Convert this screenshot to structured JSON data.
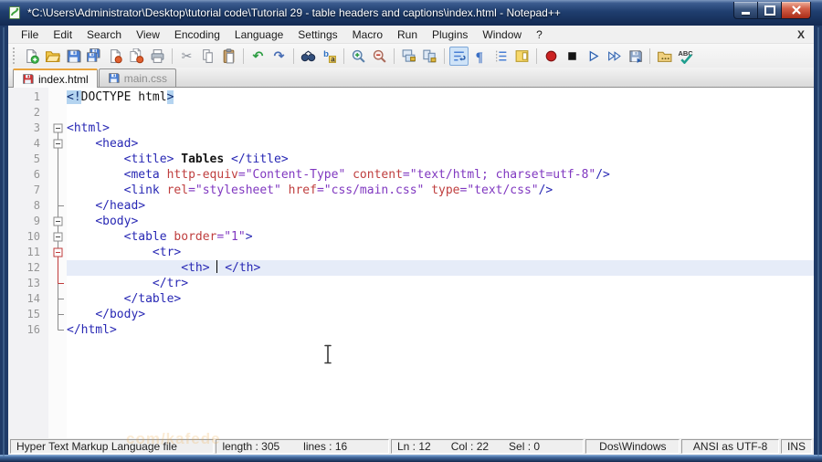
{
  "window": {
    "title": "*C:\\Users\\Administrator\\Desktop\\tutorial code\\Tutorial 29 - table headers and captions\\index.html - Notepad++"
  },
  "menu": {
    "items": [
      "File",
      "Edit",
      "Search",
      "View",
      "Encoding",
      "Language",
      "Settings",
      "Macro",
      "Run",
      "Plugins",
      "Window",
      "?"
    ],
    "right_close": "X"
  },
  "toolbar": {
    "items": [
      "new-file",
      "open-folder",
      "save",
      "save-all",
      "close-doc",
      "close-all",
      "print",
      "|",
      "cut",
      "copy",
      "paste",
      "|",
      "undo",
      "redo",
      "|",
      "find",
      "replace",
      "|",
      "zoom-in",
      "zoom-out",
      "|",
      "sync-v",
      "sync-h",
      "|",
      {
        "n": "word-wrap",
        "pressed": true
      },
      "show-all-chars",
      "indent-guide",
      "doc-map",
      "|",
      "macro-record",
      "macro-stop",
      "macro-play",
      "macro-multi",
      "macro-save",
      "|",
      "folder-workspace",
      "spell-check"
    ]
  },
  "tabs": [
    {
      "label": "index.html",
      "modified": true,
      "active": true
    },
    {
      "label": "main.css",
      "modified": false,
      "active": false
    }
  ],
  "editor": {
    "current_line": 12,
    "lines": [
      {
        "n": 1,
        "segs": [
          [
            "hl",
            "<!"
          ],
          [
            "plain",
            "DOCTYPE html"
          ],
          [
            "hl",
            ">"
          ]
        ]
      },
      {
        "n": 2,
        "segs": []
      },
      {
        "n": 3,
        "segs": [
          [
            "tag",
            "<html>"
          ]
        ]
      },
      {
        "n": 4,
        "segs": [
          [
            "plain",
            "    "
          ],
          [
            "tag",
            "<head>"
          ]
        ]
      },
      {
        "n": 5,
        "segs": [
          [
            "plain",
            "        "
          ],
          [
            "tag",
            "<title>"
          ],
          [
            "text",
            " Tables "
          ],
          [
            "tag",
            "</title>"
          ]
        ]
      },
      {
        "n": 6,
        "segs": [
          [
            "plain",
            "        "
          ],
          [
            "tag",
            "<meta "
          ],
          [
            "attr",
            "http-equiv"
          ],
          [
            "val",
            "=\"Content-Type\""
          ],
          [
            "plain",
            " "
          ],
          [
            "attr",
            "content"
          ],
          [
            "val",
            "=\"text/html; charset=utf-8\""
          ],
          [
            "tag",
            "/>"
          ]
        ]
      },
      {
        "n": 7,
        "segs": [
          [
            "plain",
            "        "
          ],
          [
            "tag",
            "<link "
          ],
          [
            "attr",
            "rel"
          ],
          [
            "val",
            "=\"stylesheet\""
          ],
          [
            "plain",
            " "
          ],
          [
            "attr",
            "href"
          ],
          [
            "val",
            "=\"css/main.css\""
          ],
          [
            "plain",
            " "
          ],
          [
            "attr",
            "type"
          ],
          [
            "val",
            "=\"text/css\""
          ],
          [
            "tag",
            "/>"
          ]
        ]
      },
      {
        "n": 8,
        "segs": [
          [
            "plain",
            "    "
          ],
          [
            "tag",
            "</head>"
          ]
        ]
      },
      {
        "n": 9,
        "segs": [
          [
            "plain",
            "    "
          ],
          [
            "tag",
            "<body>"
          ]
        ]
      },
      {
        "n": 10,
        "segs": [
          [
            "plain",
            "        "
          ],
          [
            "tag",
            "<table "
          ],
          [
            "attr",
            "border"
          ],
          [
            "val",
            "=\"1\""
          ],
          [
            "tag",
            ">"
          ]
        ]
      },
      {
        "n": 11,
        "segs": [
          [
            "plain",
            "            "
          ],
          [
            "tag",
            "<tr>"
          ]
        ]
      },
      {
        "n": 12,
        "segs": [
          [
            "plain",
            "                "
          ],
          [
            "tag",
            "<th>"
          ],
          [
            "plain",
            " "
          ],
          [
            "caret",
            ""
          ],
          [
            "plain",
            " "
          ],
          [
            "tag",
            "</th>"
          ]
        ]
      },
      {
        "n": 13,
        "segs": [
          [
            "plain",
            "            "
          ],
          [
            "tag",
            "</tr>"
          ]
        ]
      },
      {
        "n": 14,
        "segs": [
          [
            "plain",
            "        "
          ],
          [
            "tag",
            "</table>"
          ]
        ]
      },
      {
        "n": 15,
        "segs": [
          [
            "plain",
            "    "
          ],
          [
            "tag",
            "</body>"
          ]
        ]
      },
      {
        "n": 16,
        "segs": [
          [
            "tag",
            "</html>"
          ]
        ]
      }
    ],
    "folds": {
      "boxes": [
        3,
        4,
        9,
        10,
        11
      ],
      "red_box": 11,
      "spine": [
        3,
        16
      ],
      "ticks": [
        8,
        14,
        15,
        16
      ],
      "red_spine": [
        11,
        13
      ],
      "red_ticks": [
        13
      ]
    }
  },
  "status": {
    "doc_type": "Hyper Text Markup Language file",
    "length_label": "length : 305",
    "lines_label": "lines : 16",
    "ln": "Ln : 12",
    "col": "Col : 22",
    "sel": "Sel : 0",
    "eol": "Dos\\Windows",
    "encoding": "ANSI as UTF-8",
    "typing_mode": "INS"
  },
  "watermark": {
    "text": "com/kafede"
  },
  "colors": {
    "tab_accent": "#e8a33d",
    "tag": "#2828b4",
    "attr": "#bf3e3e",
    "val": "#8038c0",
    "current_line": "#e6ecf8",
    "doctype_highlight": "#b4d4f0",
    "modified_icon": "#cc3333",
    "saved_icon": "#4a7fd4",
    "fold_red": "#c03a3a"
  }
}
